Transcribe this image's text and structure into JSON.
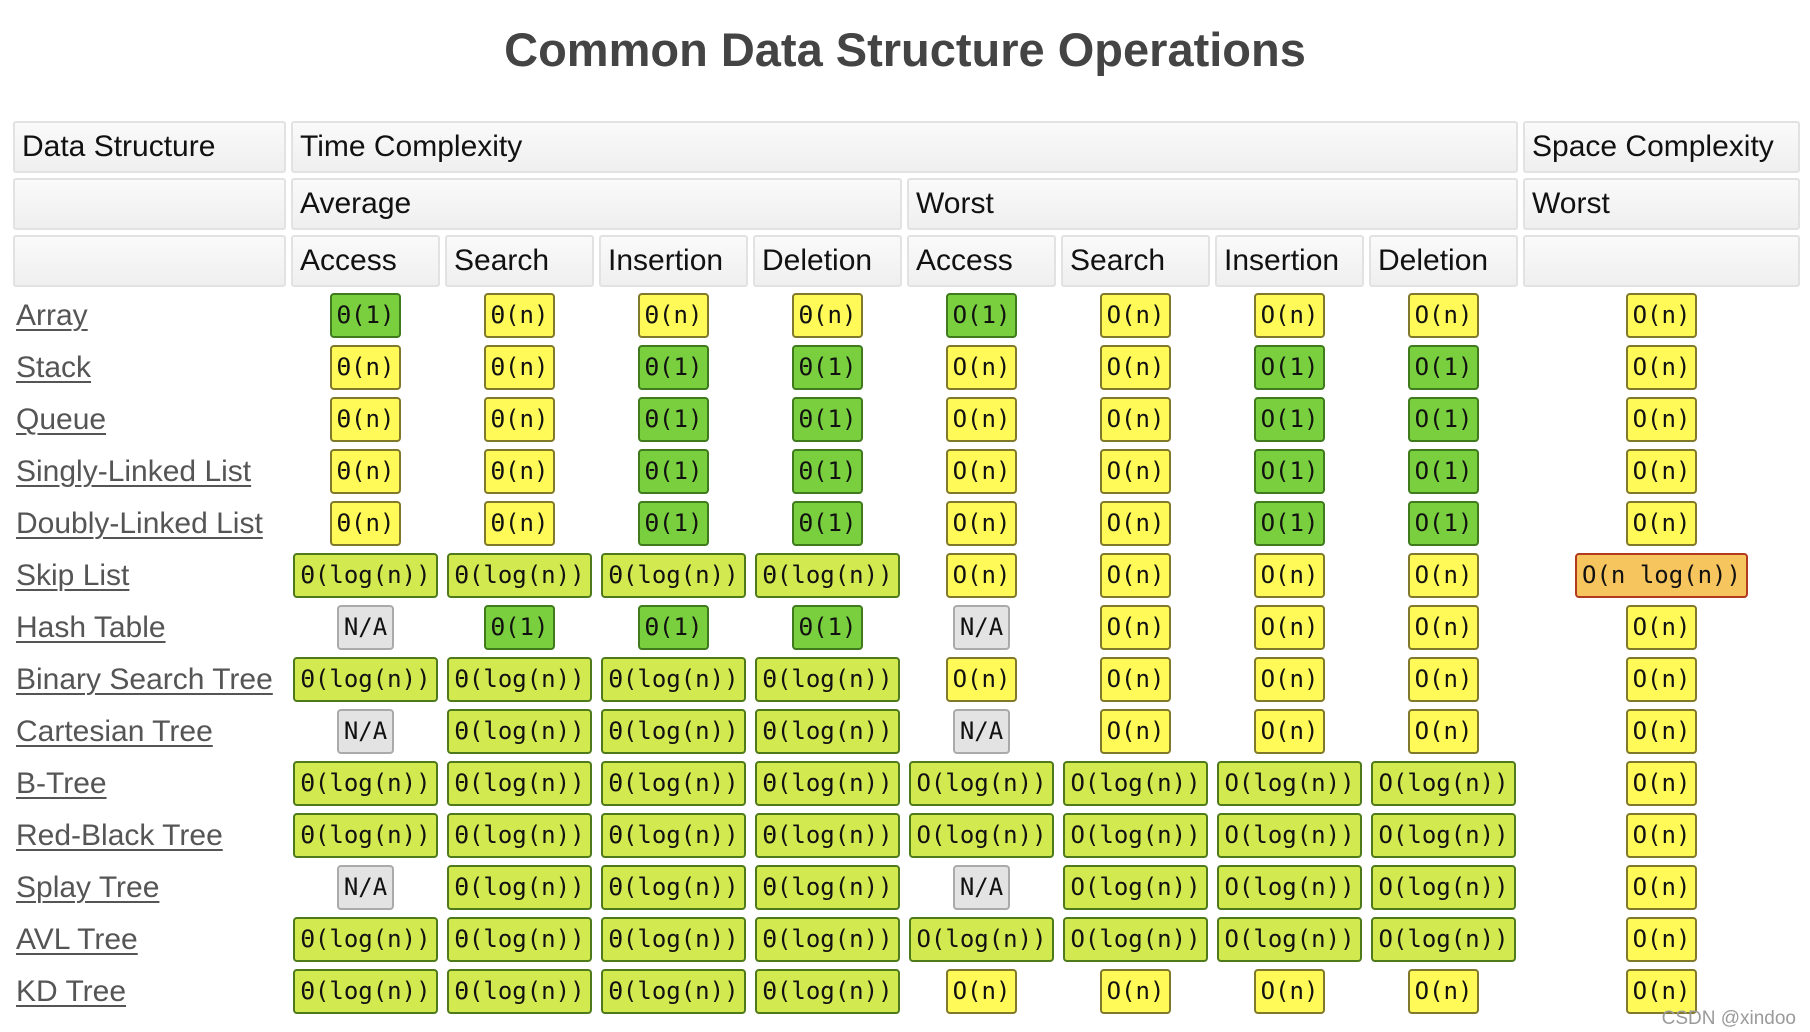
{
  "title": "Common Data Structure Operations",
  "header": {
    "row1": {
      "data_structure": "Data Structure",
      "time_complexity": "Time Complexity",
      "space_complexity": "Space Complexity"
    },
    "row2": {
      "average": "Average",
      "worst": "Worst",
      "space_worst": "Worst"
    },
    "row3": [
      "Access",
      "Search",
      "Insertion",
      "Deletion",
      "Access",
      "Search",
      "Insertion",
      "Deletion"
    ]
  },
  "colors": {
    "good": "#7acf3e",
    "fair": "#fffa57",
    "yellowgreen": "#d2ea4f",
    "bad": "#f7c55e",
    "na": "#e3e3e3"
  },
  "rows": [
    {
      "name": "Array",
      "cells": [
        {
          "v": "Θ(1)",
          "c": "good"
        },
        {
          "v": "Θ(n)",
          "c": "fair"
        },
        {
          "v": "Θ(n)",
          "c": "fair"
        },
        {
          "v": "Θ(n)",
          "c": "fair"
        },
        {
          "v": "O(1)",
          "c": "good"
        },
        {
          "v": "O(n)",
          "c": "fair"
        },
        {
          "v": "O(n)",
          "c": "fair"
        },
        {
          "v": "O(n)",
          "c": "fair"
        },
        {
          "v": "O(n)",
          "c": "fair"
        }
      ]
    },
    {
      "name": "Stack",
      "cells": [
        {
          "v": "Θ(n)",
          "c": "fair"
        },
        {
          "v": "Θ(n)",
          "c": "fair"
        },
        {
          "v": "Θ(1)",
          "c": "good"
        },
        {
          "v": "Θ(1)",
          "c": "good"
        },
        {
          "v": "O(n)",
          "c": "fair"
        },
        {
          "v": "O(n)",
          "c": "fair"
        },
        {
          "v": "O(1)",
          "c": "good"
        },
        {
          "v": "O(1)",
          "c": "good"
        },
        {
          "v": "O(n)",
          "c": "fair"
        }
      ]
    },
    {
      "name": "Queue",
      "cells": [
        {
          "v": "Θ(n)",
          "c": "fair"
        },
        {
          "v": "Θ(n)",
          "c": "fair"
        },
        {
          "v": "Θ(1)",
          "c": "good"
        },
        {
          "v": "Θ(1)",
          "c": "good"
        },
        {
          "v": "O(n)",
          "c": "fair"
        },
        {
          "v": "O(n)",
          "c": "fair"
        },
        {
          "v": "O(1)",
          "c": "good"
        },
        {
          "v": "O(1)",
          "c": "good"
        },
        {
          "v": "O(n)",
          "c": "fair"
        }
      ]
    },
    {
      "name": "Singly-Linked List",
      "cells": [
        {
          "v": "Θ(n)",
          "c": "fair"
        },
        {
          "v": "Θ(n)",
          "c": "fair"
        },
        {
          "v": "Θ(1)",
          "c": "good"
        },
        {
          "v": "Θ(1)",
          "c": "good"
        },
        {
          "v": "O(n)",
          "c": "fair"
        },
        {
          "v": "O(n)",
          "c": "fair"
        },
        {
          "v": "O(1)",
          "c": "good"
        },
        {
          "v": "O(1)",
          "c": "good"
        },
        {
          "v": "O(n)",
          "c": "fair"
        }
      ]
    },
    {
      "name": "Doubly-Linked List",
      "cells": [
        {
          "v": "Θ(n)",
          "c": "fair"
        },
        {
          "v": "Θ(n)",
          "c": "fair"
        },
        {
          "v": "Θ(1)",
          "c": "good"
        },
        {
          "v": "Θ(1)",
          "c": "good"
        },
        {
          "v": "O(n)",
          "c": "fair"
        },
        {
          "v": "O(n)",
          "c": "fair"
        },
        {
          "v": "O(1)",
          "c": "good"
        },
        {
          "v": "O(1)",
          "c": "good"
        },
        {
          "v": "O(n)",
          "c": "fair"
        }
      ]
    },
    {
      "name": "Skip List",
      "cells": [
        {
          "v": "Θ(log(n))",
          "c": "yellowgreen"
        },
        {
          "v": "Θ(log(n))",
          "c": "yellowgreen"
        },
        {
          "v": "Θ(log(n))",
          "c": "yellowgreen"
        },
        {
          "v": "Θ(log(n))",
          "c": "yellowgreen"
        },
        {
          "v": "O(n)",
          "c": "fair"
        },
        {
          "v": "O(n)",
          "c": "fair"
        },
        {
          "v": "O(n)",
          "c": "fair"
        },
        {
          "v": "O(n)",
          "c": "fair"
        },
        {
          "v": "O(n log(n))",
          "c": "bad"
        }
      ]
    },
    {
      "name": "Hash Table",
      "cells": [
        {
          "v": "N/A",
          "c": "na"
        },
        {
          "v": "Θ(1)",
          "c": "good"
        },
        {
          "v": "Θ(1)",
          "c": "good"
        },
        {
          "v": "Θ(1)",
          "c": "good"
        },
        {
          "v": "N/A",
          "c": "na"
        },
        {
          "v": "O(n)",
          "c": "fair"
        },
        {
          "v": "O(n)",
          "c": "fair"
        },
        {
          "v": "O(n)",
          "c": "fair"
        },
        {
          "v": "O(n)",
          "c": "fair"
        }
      ]
    },
    {
      "name": "Binary Search Tree",
      "cells": [
        {
          "v": "Θ(log(n))",
          "c": "yellowgreen"
        },
        {
          "v": "Θ(log(n))",
          "c": "yellowgreen"
        },
        {
          "v": "Θ(log(n))",
          "c": "yellowgreen"
        },
        {
          "v": "Θ(log(n))",
          "c": "yellowgreen"
        },
        {
          "v": "O(n)",
          "c": "fair"
        },
        {
          "v": "O(n)",
          "c": "fair"
        },
        {
          "v": "O(n)",
          "c": "fair"
        },
        {
          "v": "O(n)",
          "c": "fair"
        },
        {
          "v": "O(n)",
          "c": "fair"
        }
      ]
    },
    {
      "name": "Cartesian Tree",
      "cells": [
        {
          "v": "N/A",
          "c": "na"
        },
        {
          "v": "Θ(log(n))",
          "c": "yellowgreen"
        },
        {
          "v": "Θ(log(n))",
          "c": "yellowgreen"
        },
        {
          "v": "Θ(log(n))",
          "c": "yellowgreen"
        },
        {
          "v": "N/A",
          "c": "na"
        },
        {
          "v": "O(n)",
          "c": "fair"
        },
        {
          "v": "O(n)",
          "c": "fair"
        },
        {
          "v": "O(n)",
          "c": "fair"
        },
        {
          "v": "O(n)",
          "c": "fair"
        }
      ]
    },
    {
      "name": "B-Tree",
      "cells": [
        {
          "v": "Θ(log(n))",
          "c": "yellowgreen"
        },
        {
          "v": "Θ(log(n))",
          "c": "yellowgreen"
        },
        {
          "v": "Θ(log(n))",
          "c": "yellowgreen"
        },
        {
          "v": "Θ(log(n))",
          "c": "yellowgreen"
        },
        {
          "v": "O(log(n))",
          "c": "yellowgreen"
        },
        {
          "v": "O(log(n))",
          "c": "yellowgreen"
        },
        {
          "v": "O(log(n))",
          "c": "yellowgreen"
        },
        {
          "v": "O(log(n))",
          "c": "yellowgreen"
        },
        {
          "v": "O(n)",
          "c": "fair"
        }
      ]
    },
    {
      "name": "Red-Black Tree",
      "cells": [
        {
          "v": "Θ(log(n))",
          "c": "yellowgreen"
        },
        {
          "v": "Θ(log(n))",
          "c": "yellowgreen"
        },
        {
          "v": "Θ(log(n))",
          "c": "yellowgreen"
        },
        {
          "v": "Θ(log(n))",
          "c": "yellowgreen"
        },
        {
          "v": "O(log(n))",
          "c": "yellowgreen"
        },
        {
          "v": "O(log(n))",
          "c": "yellowgreen"
        },
        {
          "v": "O(log(n))",
          "c": "yellowgreen"
        },
        {
          "v": "O(log(n))",
          "c": "yellowgreen"
        },
        {
          "v": "O(n)",
          "c": "fair"
        }
      ]
    },
    {
      "name": "Splay Tree",
      "cells": [
        {
          "v": "N/A",
          "c": "na"
        },
        {
          "v": "Θ(log(n))",
          "c": "yellowgreen"
        },
        {
          "v": "Θ(log(n))",
          "c": "yellowgreen"
        },
        {
          "v": "Θ(log(n))",
          "c": "yellowgreen"
        },
        {
          "v": "N/A",
          "c": "na"
        },
        {
          "v": "O(log(n))",
          "c": "yellowgreen"
        },
        {
          "v": "O(log(n))",
          "c": "yellowgreen"
        },
        {
          "v": "O(log(n))",
          "c": "yellowgreen"
        },
        {
          "v": "O(n)",
          "c": "fair"
        }
      ]
    },
    {
      "name": "AVL Tree",
      "cells": [
        {
          "v": "Θ(log(n))",
          "c": "yellowgreen"
        },
        {
          "v": "Θ(log(n))",
          "c": "yellowgreen"
        },
        {
          "v": "Θ(log(n))",
          "c": "yellowgreen"
        },
        {
          "v": "Θ(log(n))",
          "c": "yellowgreen"
        },
        {
          "v": "O(log(n))",
          "c": "yellowgreen"
        },
        {
          "v": "O(log(n))",
          "c": "yellowgreen"
        },
        {
          "v": "O(log(n))",
          "c": "yellowgreen"
        },
        {
          "v": "O(log(n))",
          "c": "yellowgreen"
        },
        {
          "v": "O(n)",
          "c": "fair"
        }
      ]
    },
    {
      "name": "KD Tree",
      "cells": [
        {
          "v": "Θ(log(n))",
          "c": "yellowgreen"
        },
        {
          "v": "Θ(log(n))",
          "c": "yellowgreen"
        },
        {
          "v": "Θ(log(n))",
          "c": "yellowgreen"
        },
        {
          "v": "Θ(log(n))",
          "c": "yellowgreen"
        },
        {
          "v": "O(n)",
          "c": "fair"
        },
        {
          "v": "O(n)",
          "c": "fair"
        },
        {
          "v": "O(n)",
          "c": "fair"
        },
        {
          "v": "O(n)",
          "c": "fair"
        },
        {
          "v": "O(n)",
          "c": "fair"
        }
      ]
    }
  ],
  "watermark": "CSDN @xindoo"
}
